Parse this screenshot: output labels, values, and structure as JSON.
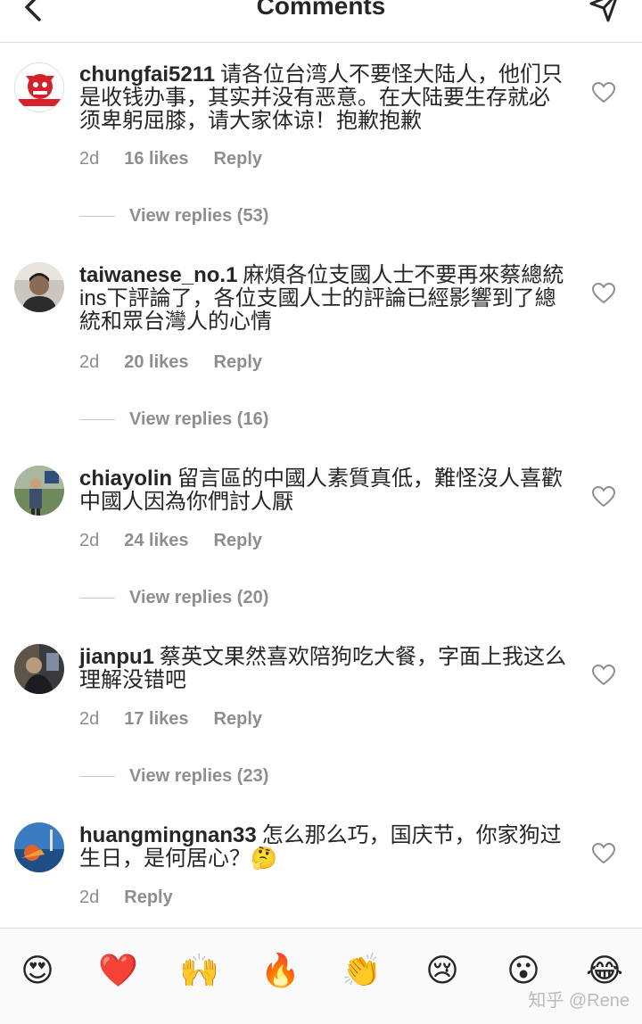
{
  "header": {
    "title": "Comments"
  },
  "comments": [
    {
      "username": "chungfai5211",
      "text": "请各位台湾人不要怪大陆人，他们只是收钱办事，其实并没有恶意。在大陆要生存就必须卑躬屈膝，请大家体谅！抱歉抱歉",
      "time": "2d",
      "likes": "16 likes",
      "reply": "Reply",
      "view_replies": "View replies (53)"
    },
    {
      "username": "taiwanese_no.1",
      "text": "麻煩各位支國人士不要再來蔡總統ins下評論了，各位支國人士的評論已經影響到了總統和眾台灣人的心情",
      "time": "2d",
      "likes": "20 likes",
      "reply": "Reply",
      "view_replies": "View replies (16)"
    },
    {
      "username": "chiayolin",
      "text": "留言區的中國人素質真低，難怪沒人喜歡中國人因為你們討人厭",
      "time": "2d",
      "likes": "24 likes",
      "reply": "Reply",
      "view_replies": "View replies (20)"
    },
    {
      "username": "jianpu1",
      "text": "蔡英文果然喜欢陪狗吃大餐，字面上我这么理解没错吧",
      "time": "2d",
      "likes": "17 likes",
      "reply": "Reply",
      "view_replies": "View replies (23)"
    },
    {
      "username": "huangmingnan33",
      "text": "怎么那么巧，国庆节，你家狗过生日，是何居心？🤔",
      "time": "2d",
      "reply": "Reply"
    }
  ],
  "emoji_bar": {
    "emojis": [
      "😍",
      "❤️",
      "🙌",
      "🔥",
      "👏",
      "😢",
      "😮",
      "😂"
    ]
  },
  "watermark": "知乎 @Rene"
}
